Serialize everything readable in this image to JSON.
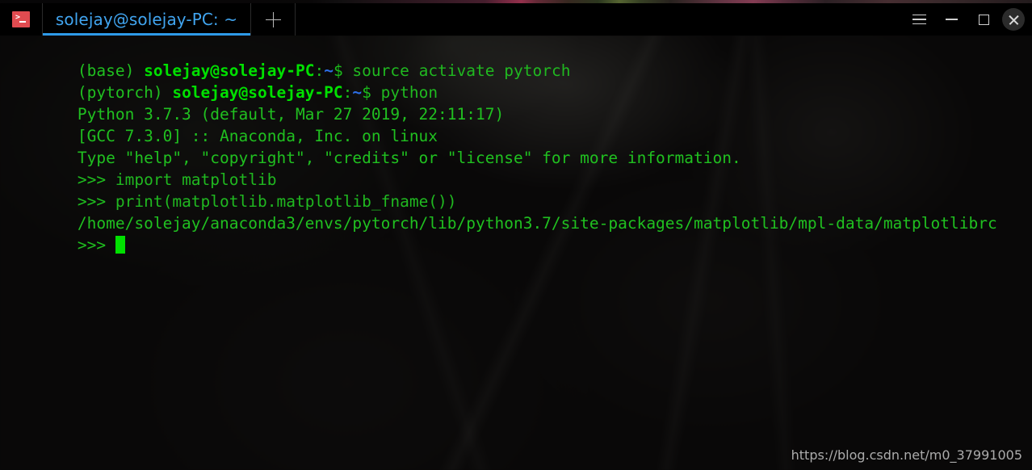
{
  "window": {
    "app_icon": "terminal-prompt-icon",
    "tab_title": "solejay@solejay-PC: ~",
    "new_tab_label": "+",
    "controls": {
      "menu": "hamburger-menu-icon",
      "minimize": "minimize-icon",
      "maximize": "maximize-icon",
      "close": "close-icon"
    },
    "accent_color": "#2e9ae8",
    "tab_title_color": "#41a5f0",
    "icon_color": "#e14b50"
  },
  "terminal": {
    "background_color": "#0b0a0a",
    "foreground_color": "#20c020",
    "cursor_color": "#00e000",
    "lines": [
      {
        "type": "prompt",
        "venv": "(base) ",
        "userhost": "solejay@solejay-PC",
        "colon": ":",
        "tilde": "~",
        "dollar": "$ ",
        "command": "source activate pytorch"
      },
      {
        "type": "prompt",
        "venv": "(pytorch) ",
        "userhost": "solejay@solejay-PC",
        "colon": ":",
        "tilde": "~",
        "dollar": "$ ",
        "command": "python"
      },
      {
        "type": "output",
        "text": "Python 3.7.3 (default, Mar 27 2019, 22:11:17)"
      },
      {
        "type": "output",
        "text": "[GCC 7.3.0] :: Anaconda, Inc. on linux"
      },
      {
        "type": "output",
        "text": "Type \"help\", \"copyright\", \"credits\" or \"license\" for more information."
      },
      {
        "type": "py",
        "prompt": ">>> ",
        "text": "import matplotlib"
      },
      {
        "type": "py",
        "prompt": ">>> ",
        "text": "print(matplotlib.matplotlib_fname())"
      },
      {
        "type": "output",
        "text": "/home/solejay/anaconda3/envs/pytorch/lib/python3.7/site-packages/matplotlib/mpl-data/matplotlibrc"
      },
      {
        "type": "cursor",
        "prompt": ">>> "
      }
    ]
  },
  "watermark": {
    "text": "https://blog.csdn.net/m0_37991005"
  }
}
